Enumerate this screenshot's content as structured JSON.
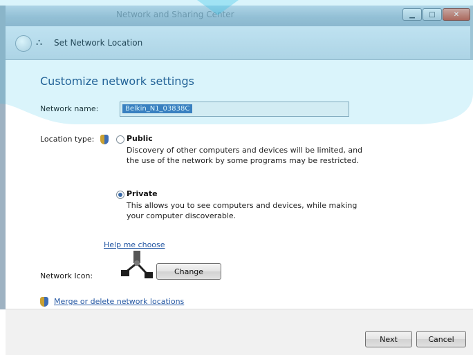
{
  "window": {
    "title": "Network and Sharing Center",
    "controls": [
      "minimize",
      "maximize",
      "close"
    ]
  },
  "nav": {
    "title": "Set Network Location"
  },
  "page": {
    "heading": "Customize network settings",
    "network_name_label": "Network name:",
    "network_name_value": "Belkin_N1_03838C",
    "location_type_label": "Location type:",
    "options": [
      {
        "title": "Public",
        "selected": false,
        "description_line1": "Discovery of other computers and devices will be limited, and",
        "description_line2": "the use of the network by some programs may be restricted."
      },
      {
        "title": "Private",
        "selected": true,
        "description_line1": "This allows you to see computers and devices, while making",
        "description_line2": "your computer discoverable."
      }
    ],
    "help_link": "Help me choose",
    "network_icon_label": "Network Icon:",
    "change_button": "Change",
    "merge_link": "Merge or delete network locations"
  },
  "footer": {
    "next_button": "Next",
    "cancel_button": "Cancel"
  },
  "colors": {
    "accent": "#1f4e86",
    "link": "#2457a3",
    "overlay": "#33c2e8"
  }
}
